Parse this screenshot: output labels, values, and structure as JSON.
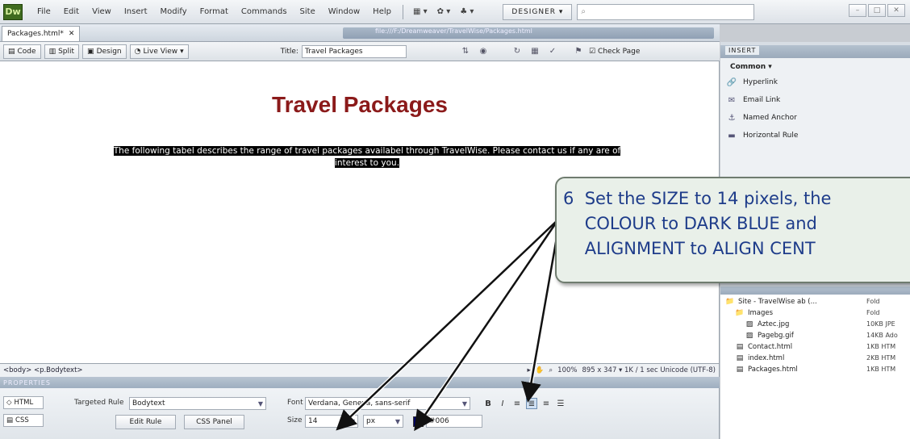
{
  "app": {
    "logo": "Dw",
    "menu": [
      "File",
      "Edit",
      "View",
      "Insert",
      "Modify",
      "Format",
      "Commands",
      "Site",
      "Window",
      "Help"
    ],
    "workspace": "DESIGNER ▾",
    "search_placeholder": ""
  },
  "document": {
    "tab_label": "Packages.html*",
    "path": "file:///F:/Dreamweaver/TravelWise/Packages.html",
    "view_buttons": [
      "Code",
      "Split",
      "Design",
      "Live View"
    ],
    "title_label": "Title:",
    "title_value": "Travel Packages",
    "check_page": "Check Page"
  },
  "design": {
    "heading": "Travel Packages",
    "body_line1": "The following tabel describes the range of travel packages availabel through TravelWise. Please contact us if any are of",
    "body_line2": "interest to you."
  },
  "status": {
    "tag_selector": "<body> <p.Bodytext>",
    "zoom": "100%",
    "info": "895 x 347 ▾  1K / 1 sec  Unicode (UTF-8)"
  },
  "properties": {
    "header": "PROPERTIES",
    "html_mode": "HTML",
    "css_mode": "CSS",
    "targeted_rule_label": "Targeted Rule",
    "targeted_rule": "Bodytext",
    "edit_rule": "Edit Rule",
    "css_panel": "CSS Panel",
    "font_label": "Font",
    "font_value": "Verdana, Geneva, sans-serif",
    "size_label": "Size",
    "size_value": "14",
    "size_unit": "px",
    "color_hex": "#006",
    "color_swatch": "#000066",
    "bold": "B",
    "italic": "I"
  },
  "insert_panel": {
    "tab": "INSERT",
    "category": "Common ▾",
    "items": [
      "Hyperlink",
      "Email Link",
      "Named Anchor",
      "Horizontal Rule"
    ]
  },
  "files_panel": {
    "rows": [
      {
        "name": "Site - TravelWise ab (...",
        "size": "Fold"
      },
      {
        "name": "Images",
        "size": "Fold"
      },
      {
        "name": "Aztec.jpg",
        "size": "10KB JPE"
      },
      {
        "name": "Pagebg.gif",
        "size": "14KB Ado"
      },
      {
        "name": "Contact.html",
        "size": "1KB HTM"
      },
      {
        "name": "index.html",
        "size": "2KB HTM"
      },
      {
        "name": "Packages.html",
        "size": "1KB HTM"
      }
    ]
  },
  "callout": {
    "text": "6  Set the SIZE to 14 pixels, the\n    COLOUR to DARK BLUE and\n    ALIGNMENT to ALIGN CENT"
  }
}
